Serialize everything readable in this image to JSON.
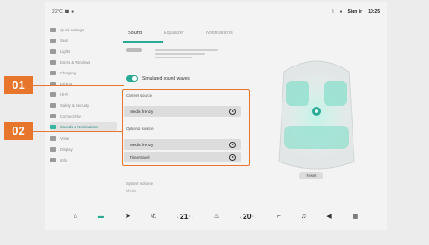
{
  "status_bar": {
    "left": "22°C",
    "user": "Sign in",
    "time": "10:25"
  },
  "sidebar": {
    "items": [
      {
        "label": "Quick settings"
      },
      {
        "label": "Seat"
      },
      {
        "label": "Lights"
      },
      {
        "label": "Doors & Windows"
      },
      {
        "label": "Charging"
      },
      {
        "label": "Driving"
      },
      {
        "label": "Hi-Fi"
      },
      {
        "label": "Safety & Security"
      },
      {
        "label": "Connectivity"
      },
      {
        "label": "Sounds & Notifications"
      },
      {
        "label": "Voice"
      },
      {
        "label": "Display"
      },
      {
        "label": "Info"
      }
    ]
  },
  "tabs": [
    {
      "label": "Sound"
    },
    {
      "label": "Equalizer"
    },
    {
      "label": "Notifications"
    }
  ],
  "toggle": {
    "label": "Simulated sound waves",
    "state": "on"
  },
  "current_source": {
    "title": "Current source",
    "items": [
      {
        "label": "Media frenzy"
      }
    ]
  },
  "optional_source": {
    "title": "Optional source",
    "items": [
      {
        "label": "Media frenzy"
      },
      {
        "label": "Time travel"
      }
    ]
  },
  "system_volume": {
    "label": "System volume",
    "sub": "Media"
  },
  "reset_label": "Reset",
  "bottom_bar": {
    "temp_left": "21",
    "temp_right": "20",
    "temp_unit": "°"
  },
  "callouts": {
    "c1": "01",
    "c2": "02"
  },
  "colors": {
    "accent": "#2aa994",
    "callout": "#e8752c"
  }
}
